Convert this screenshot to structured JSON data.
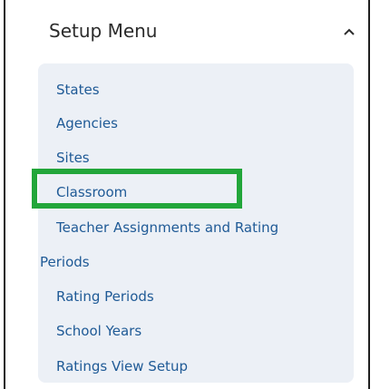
{
  "header": {
    "title": "Setup Menu",
    "chevron_icon": "chevron-up-icon"
  },
  "menu": {
    "items": [
      {
        "label": "States"
      },
      {
        "label": "Agencies"
      },
      {
        "label": "Sites"
      },
      {
        "label": "Classroom",
        "highlighted": true
      },
      {
        "label": "Teacher Assignments and Rating"
      },
      {
        "label": "Periods"
      },
      {
        "label": "Rating Periods"
      },
      {
        "label": "School Years"
      },
      {
        "label": "Ratings View Setup"
      }
    ]
  },
  "colors": {
    "panel_background": "#ecf0f6",
    "link_text": "#1f5a96",
    "highlight_border": "#22a63a"
  }
}
